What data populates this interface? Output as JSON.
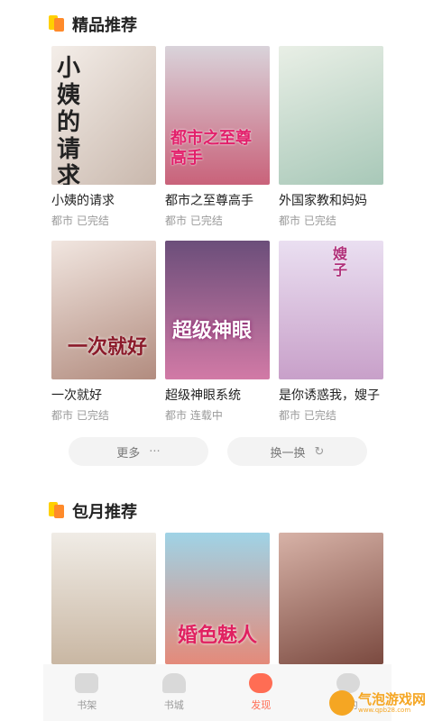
{
  "featured": {
    "title": "精品推荐",
    "books": [
      {
        "title": "小姨的请求",
        "meta": "都市 已完结",
        "cover_text": "小姨的请求",
        "cover_colors": [
          "#f4eee9",
          "#c9b8ad"
        ]
      },
      {
        "title": "都市之至尊高手",
        "meta": "都市 已完结",
        "cover_text": "都市之至尊高手",
        "cover_colors": [
          "#d9d3da",
          "#c9627a"
        ]
      },
      {
        "title": "外国家教和妈妈",
        "meta": "都市 已完结",
        "cover_text": "",
        "cover_colors": [
          "#e9efe6",
          "#a8c8b8"
        ]
      },
      {
        "title": "一次就好",
        "meta": "都市 已完结",
        "cover_text": "一次就好",
        "cover_colors": [
          "#f1e6e0",
          "#b28c7f"
        ]
      },
      {
        "title": "超级神眼系统",
        "meta": "都市 连载中",
        "cover_text": "超级神眼",
        "cover_colors": [
          "#6b4e7a",
          "#d27aa6"
        ]
      },
      {
        "title": "是你诱惑我，嫂子",
        "meta": "都市 已完结",
        "cover_text": "嫂子",
        "cover_colors": [
          "#eadff1",
          "#c8a0c9"
        ]
      }
    ]
  },
  "actions": {
    "more_label": "更多",
    "more_icon": "···",
    "refresh_label": "换一换",
    "refresh_icon": "↻"
  },
  "monthly": {
    "title": "包月推荐",
    "books": [
      {
        "cover_colors": [
          "#f0ece6",
          "#c9b7a3"
        ]
      },
      {
        "cover_text": "婚色魅人",
        "cover_colors": [
          "#9fd3e6",
          "#e48a7a"
        ]
      },
      {
        "cover_colors": [
          "#d7b2a7",
          "#7b4a40"
        ]
      }
    ]
  },
  "tabbar": {
    "items": [
      {
        "label": "书架",
        "icon": "bookshelf-icon"
      },
      {
        "label": "书城",
        "icon": "bookstore-icon"
      },
      {
        "label": "发现",
        "icon": "discover-icon",
        "active": true
      },
      {
        "label": "我的",
        "icon": "profile-icon"
      }
    ]
  },
  "watermark": {
    "text": "气泡游戏网",
    "url": "www.qpb28.com"
  },
  "colors": {
    "accent": "#ff6d54",
    "icon_yellow": "#ffd000",
    "icon_orange": "#ff8a2a"
  }
}
